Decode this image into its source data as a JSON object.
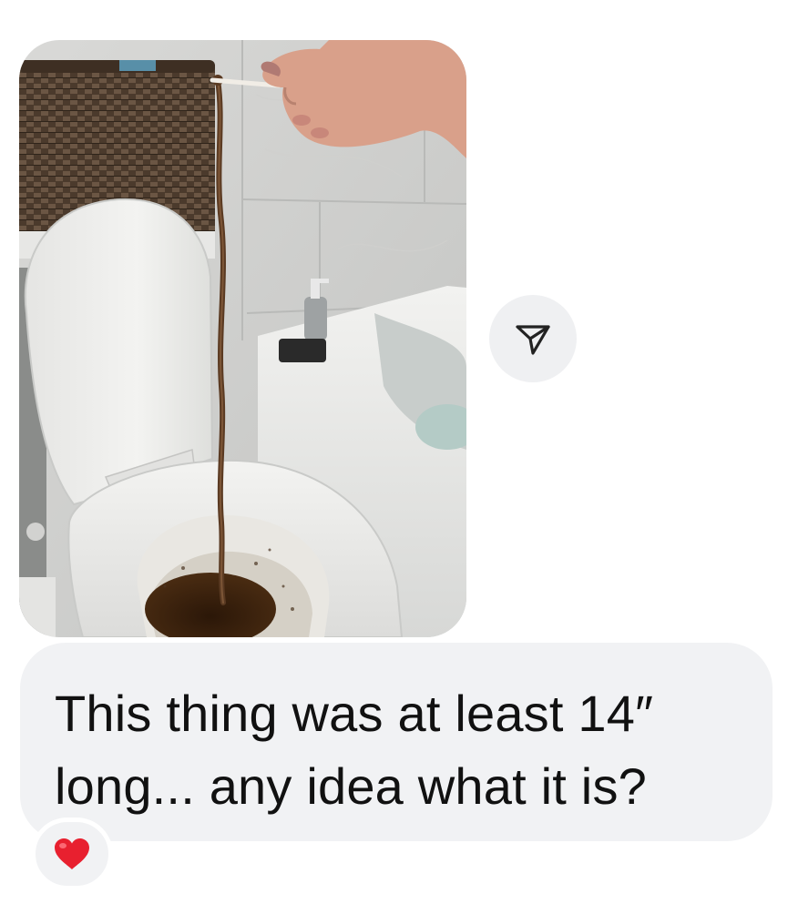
{
  "message": {
    "text": "This thing was at least 14″ long... any idea what it is?"
  },
  "reaction": {
    "emoji_icon": "heart-icon",
    "color": "#e8202f"
  },
  "share": {
    "icon": "send-arrow-icon"
  },
  "colors": {
    "bubble": "#f1f2f4",
    "text": "#111111"
  }
}
